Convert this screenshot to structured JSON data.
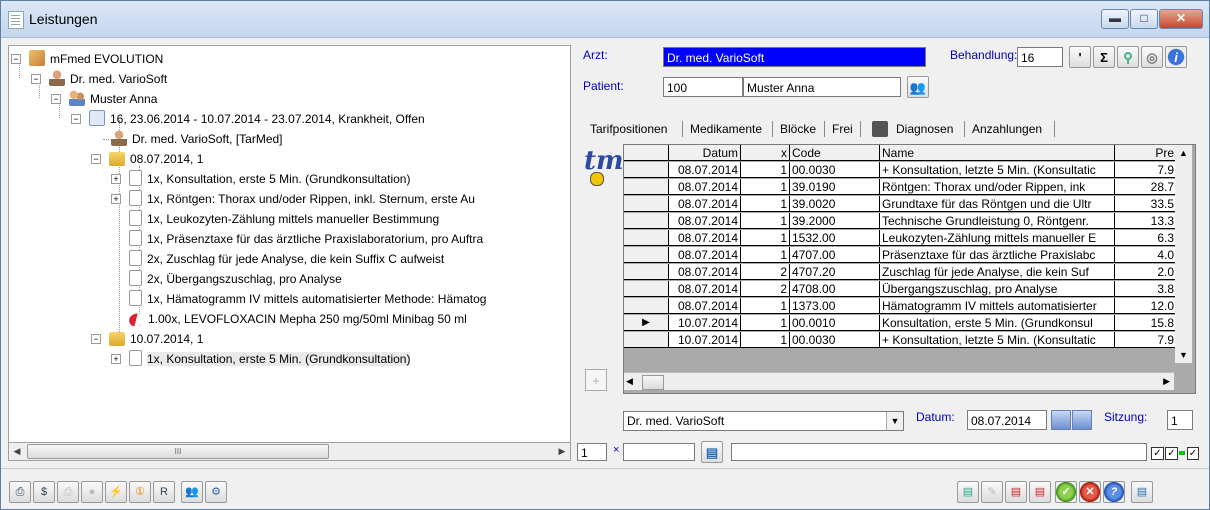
{
  "window": {
    "title": "Leistungen",
    "minimize": "▬",
    "maximize": "□",
    "close": "✕"
  },
  "tree": {
    "root": "mFmed EVOLUTION",
    "doctor": "Dr. med. VarioSoft",
    "patient": "Muster Anna",
    "case": "16,  23.06.2014 - 10.07.2014 - 23.07.2014, Krankheit, Offen",
    "case_doctor": "Dr. med. VarioSoft, [TarMed]",
    "session1": "08.07.2014, 1",
    "session1_items": [
      "1x, Konsultation, erste 5 Min. (Grundkonsultation)",
      "1x, Röntgen: Thorax und/oder Rippen, inkl. Sternum, erste Au",
      "1x, Leukozyten-Zählung mittels manueller Bestimmung",
      "1x, Präsenztaxe für das ärztliche Praxislaboratorium, pro Auftra",
      "2x, Zuschlag für jede Analyse, die kein Suffix C aufweist",
      "2x, Übergangszuschlag, pro Analyse",
      "1x, Hämatogramm IV mittels automatisierter Methode: Hämatog",
      "1.00x, LEVOFLOXACIN Mepha 250 mg/50ml Minibag 50 ml"
    ],
    "session2": "10.07.2014, 1",
    "session2_items": [
      "1x, Konsultation, erste 5 Min. (Grundkonsultation)"
    ],
    "scroll_grip": "III"
  },
  "header": {
    "arzt_label": "Arzt:",
    "arzt_value": "Dr. med. VarioSoft",
    "patient_label": "Patient:",
    "patient_id": "100",
    "patient_name": "Muster Anna",
    "behandlung_label": "Behandlung:",
    "behandlung_value": "16"
  },
  "tabs": [
    "Tarifpositionen",
    "Medikamente",
    "Blöcke",
    "Frei",
    "Diagnosen",
    "Anzahlungen"
  ],
  "logo": "tm",
  "grid": {
    "columns": [
      "Datum",
      "x",
      "Code",
      "Name",
      "Pre"
    ],
    "rows": [
      {
        "datum": "08.07.2014",
        "x": "1",
        "code": "00.0030",
        "name": "+ Konsultation, letzte 5 Min. (Konsultatic",
        "pre": "7.9"
      },
      {
        "datum": "08.07.2014",
        "x": "1",
        "code": "39.0190",
        "name": "Röntgen: Thorax und/oder Rippen, ink",
        "pre": "28.7"
      },
      {
        "datum": "08.07.2014",
        "x": "1",
        "code": "39.0020",
        "name": "Grundtaxe für das Röntgen und die Ultr",
        "pre": "33.5"
      },
      {
        "datum": "08.07.2014",
        "x": "1",
        "code": "39.2000",
        "name": "Technische Grundleistung 0, Röntgenr.",
        "pre": "13.3"
      },
      {
        "datum": "08.07.2014",
        "x": "1",
        "code": "1532.00",
        "name": "Leukozyten-Zählung mittels manueller E",
        "pre": "6.3"
      },
      {
        "datum": "08.07.2014",
        "x": "1",
        "code": "4707.00",
        "name": "Präsenztaxe für das ärztliche Praxislabc",
        "pre": "4.0"
      },
      {
        "datum": "08.07.2014",
        "x": "2",
        "code": "4707.20",
        "name": "Zuschlag für jede Analyse, die kein Suf",
        "pre": "2.0"
      },
      {
        "datum": "08.07.2014",
        "x": "2",
        "code": "4708.00",
        "name": "Übergangszuschlag, pro Analyse",
        "pre": "3.8"
      },
      {
        "datum": "08.07.2014",
        "x": "1",
        "code": "1373.00",
        "name": "Hämatogramm IV mittels automatisierter",
        "pre": "12.0"
      },
      {
        "datum": "10.07.2014",
        "x": "1",
        "code": "00.0010",
        "name": "Konsultation, erste 5 Min. (Grundkonsul",
        "pre": "15.8"
      },
      {
        "datum": "10.07.2014",
        "x": "1",
        "code": "00.0030",
        "name": "+ Konsultation, letzte 5 Min. (Konsultatic",
        "pre": "7.9"
      }
    ],
    "current_row": 9
  },
  "bottom": {
    "doctor_select": "Dr. med. VarioSoft",
    "datum_label": "Datum:",
    "datum_value": "08.07.2014",
    "sitzung_label": "Sitzung:",
    "sitzung_value": "1",
    "qty_value": "1",
    "x_label": "×",
    "code_value": "",
    "name_value": ""
  },
  "colors": {
    "label_blue": "#0000c0",
    "arzt_bg": "#0000ff"
  }
}
